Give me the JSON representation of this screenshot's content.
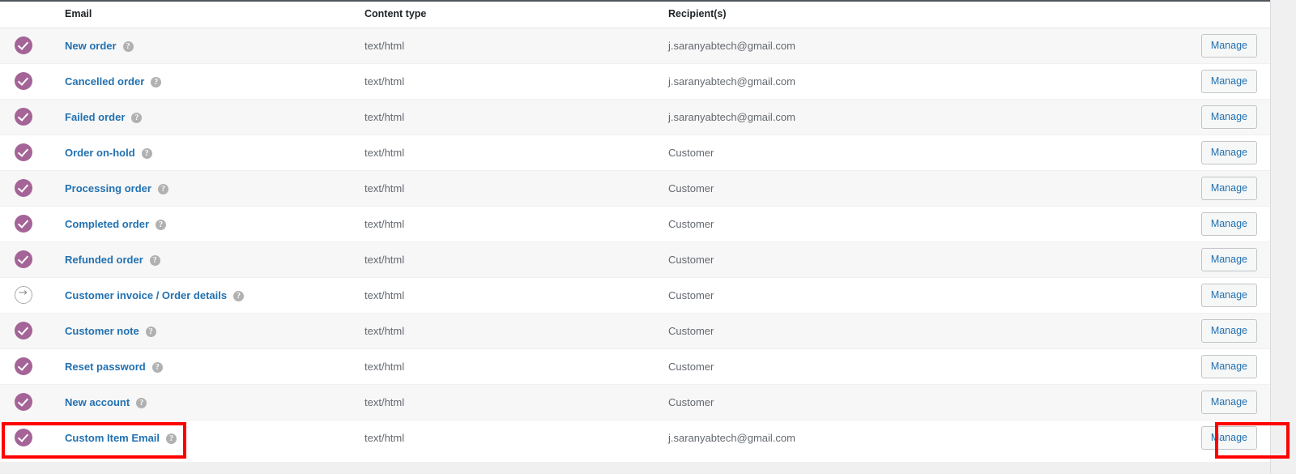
{
  "table": {
    "columns": {
      "status": "",
      "email": "Email",
      "content_type": "Content type",
      "recipients": "Recipient(s)",
      "actions": ""
    },
    "action_label": "Manage",
    "help_glyph": "?",
    "rows": [
      {
        "status_icon": "check-circle-icon",
        "status_enabled": true,
        "name": "New order",
        "content_type": "text/html",
        "recipient": "j.saranyabtech@gmail.com",
        "action": "Manage"
      },
      {
        "status_icon": "check-circle-icon",
        "status_enabled": true,
        "name": "Cancelled order",
        "content_type": "text/html",
        "recipient": "j.saranyabtech@gmail.com",
        "action": "Manage"
      },
      {
        "status_icon": "check-circle-icon",
        "status_enabled": true,
        "name": "Failed order",
        "content_type": "text/html",
        "recipient": "j.saranyabtech@gmail.com",
        "action": "Manage"
      },
      {
        "status_icon": "check-circle-icon",
        "status_enabled": true,
        "name": "Order on-hold",
        "content_type": "text/html",
        "recipient": "Customer",
        "action": "Manage"
      },
      {
        "status_icon": "check-circle-icon",
        "status_enabled": true,
        "name": "Processing order",
        "content_type": "text/html",
        "recipient": "Customer",
        "action": "Manage"
      },
      {
        "status_icon": "check-circle-icon",
        "status_enabled": true,
        "name": "Completed order",
        "content_type": "text/html",
        "recipient": "Customer",
        "action": "Manage"
      },
      {
        "status_icon": "check-circle-icon",
        "status_enabled": true,
        "name": "Refunded order",
        "content_type": "text/html",
        "recipient": "Customer",
        "action": "Manage"
      },
      {
        "status_icon": "arrow-circle-icon",
        "status_enabled": false,
        "name": "Customer invoice / Order details",
        "content_type": "text/html",
        "recipient": "Customer",
        "action": "Manage"
      },
      {
        "status_icon": "check-circle-icon",
        "status_enabled": true,
        "name": "Customer note",
        "content_type": "text/html",
        "recipient": "Customer",
        "action": "Manage"
      },
      {
        "status_icon": "check-circle-icon",
        "status_enabled": true,
        "name": "Reset password",
        "content_type": "text/html",
        "recipient": "Customer",
        "action": "Manage"
      },
      {
        "status_icon": "check-circle-icon",
        "status_enabled": true,
        "name": "New account",
        "content_type": "text/html",
        "recipient": "Customer",
        "action": "Manage"
      },
      {
        "status_icon": "check-circle-icon",
        "status_enabled": true,
        "name": "Custom Item Email",
        "content_type": "text/html",
        "recipient": "j.saranyabtech@gmail.com",
        "action": "Manage"
      }
    ]
  },
  "annotations": {
    "color": "#ff0000",
    "highlight_row_name": "Custom Item Email",
    "highlight_button_label": "Manage"
  },
  "colors": {
    "link": "#2271b1",
    "enabled_icon": "#a46497",
    "disabled_icon": "#a7aaad",
    "text": "#646970",
    "annotation": "#ff0000"
  }
}
